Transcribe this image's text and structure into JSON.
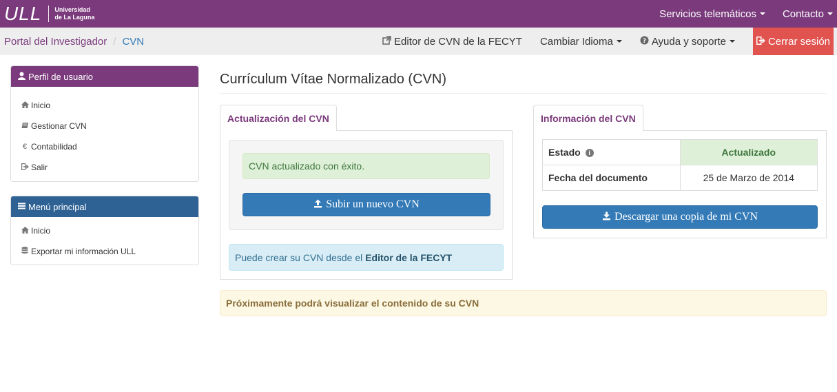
{
  "header": {
    "logo_mark": "ULL",
    "logo_line1": "Universidad",
    "logo_line2": "de La Laguna",
    "menu": [
      {
        "label": "Servicios telemáticos"
      },
      {
        "label": "Contacto"
      }
    ]
  },
  "breadcrumb": {
    "home": "Portal del Investigador",
    "separator": "/",
    "current": "CVN"
  },
  "subnav": {
    "editor_label": "Editor de CVN de la FECYT",
    "language_label": "Cambiar Idioma",
    "help_label": "Ayuda y soporte",
    "logout_label": "Cerrar sesión"
  },
  "user_panel": {
    "title": "Perfil de usuario",
    "items": [
      {
        "label": "Inicio",
        "icon": "home-icon"
      },
      {
        "label": "Gestionar CVN",
        "icon": "book-icon"
      },
      {
        "label": "Contabilidad",
        "icon": "euro-icon"
      },
      {
        "label": "Salir",
        "icon": "log-out-icon"
      }
    ]
  },
  "main_menu": {
    "title": "Menú principal",
    "items": [
      {
        "label": "Inicio",
        "icon": "home-icon"
      },
      {
        "label": "Exportar mi información ULL",
        "icon": "database-icon"
      }
    ]
  },
  "page": {
    "title": "Currículum Vítae Normalizado (CVN)"
  },
  "update_tab": {
    "label": "Actualización del CVN",
    "success_message": "CVN actualizado con éxito.",
    "upload_button": "Subir un nuevo CVN",
    "info_text": "Puede crear su CVN desde el",
    "info_link": "Editor de la FECYT"
  },
  "info_tab": {
    "label": "Información del CVN",
    "rows": [
      {
        "label": "Estado",
        "value": "Actualizado"
      },
      {
        "label": "Fecha del documento",
        "value": "25 de Marzo de 2014"
      }
    ],
    "download_button": "Descargar una copia de mi CVN"
  },
  "notice": {
    "text": "Próximamente podrá visualizar el contenido de su CVN"
  },
  "colors": {
    "brand": "#7a3a7c",
    "primary": "#337ab7",
    "danger": "#e0534f",
    "success_bg": "#dff0d8",
    "info_bg": "#d9edf7",
    "warning_bg": "#fcf8e3",
    "menu_header": "#2f6294"
  }
}
